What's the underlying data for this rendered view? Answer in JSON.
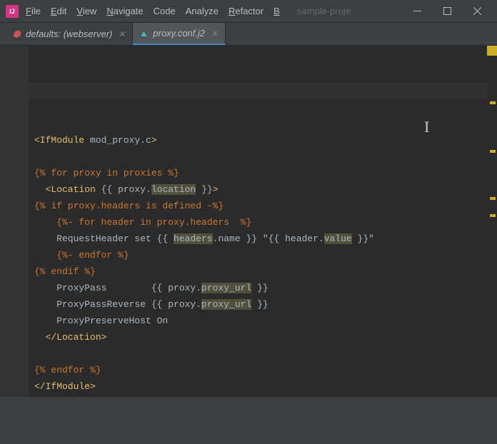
{
  "menus": {
    "file": "File",
    "edit": "Edit",
    "view": "View",
    "navigate": "Navigate",
    "code": "Code",
    "analyze": "Analyze",
    "refactor": "Refactor",
    "build_prefix": "B",
    "project": "sample-proje"
  },
  "tabs": [
    {
      "label": "defaults: (webserver)",
      "active": false
    },
    {
      "label": "proxy.conf.j2",
      "active": true
    }
  ],
  "icons": {
    "tab0": "⬢",
    "tab1": "▲"
  },
  "code": {
    "l1_open": "<IfModule ",
    "l1_attr": "mod_proxy.c",
    "l1_close": ">",
    "l2": "",
    "l3": "{% for proxy in proxies %}",
    "l4_open": "  <Location ",
    "l4_expr": "{{ proxy.",
    "l4_warn": "location",
    "l4_end": " }}",
    "l4_close": ">",
    "l5": "{% if proxy.headers is defined -%}",
    "l6": "    {%- for header in proxy.headers  %}",
    "l7_a": "    RequestHeader set ",
    "l7_b": "{{ ",
    "l7_warn": "headers",
    "l7_c": ".name }}",
    "l7_d": " \"",
    "l7_e": "{{ header.",
    "l7_warn2": "value",
    "l7_f": " }}",
    "l7_g": "\"",
    "l8": "    {%- endfor %}",
    "l9": "{% endif %}",
    "l10_a": "    ProxyPass        ",
    "l10_b": "{{ proxy.",
    "l10_warn": "proxy_url",
    "l10_c": " }}",
    "l11_a": "    ProxyPassReverse ",
    "l11_b": "{{ proxy.",
    "l11_warn": "proxy_url",
    "l11_c": " }}",
    "l12": "    ProxyPreserveHost On",
    "l13": "  </Location>",
    "l14": "",
    "l15": "{% endfor %}",
    "l16": "</IfModule>"
  }
}
